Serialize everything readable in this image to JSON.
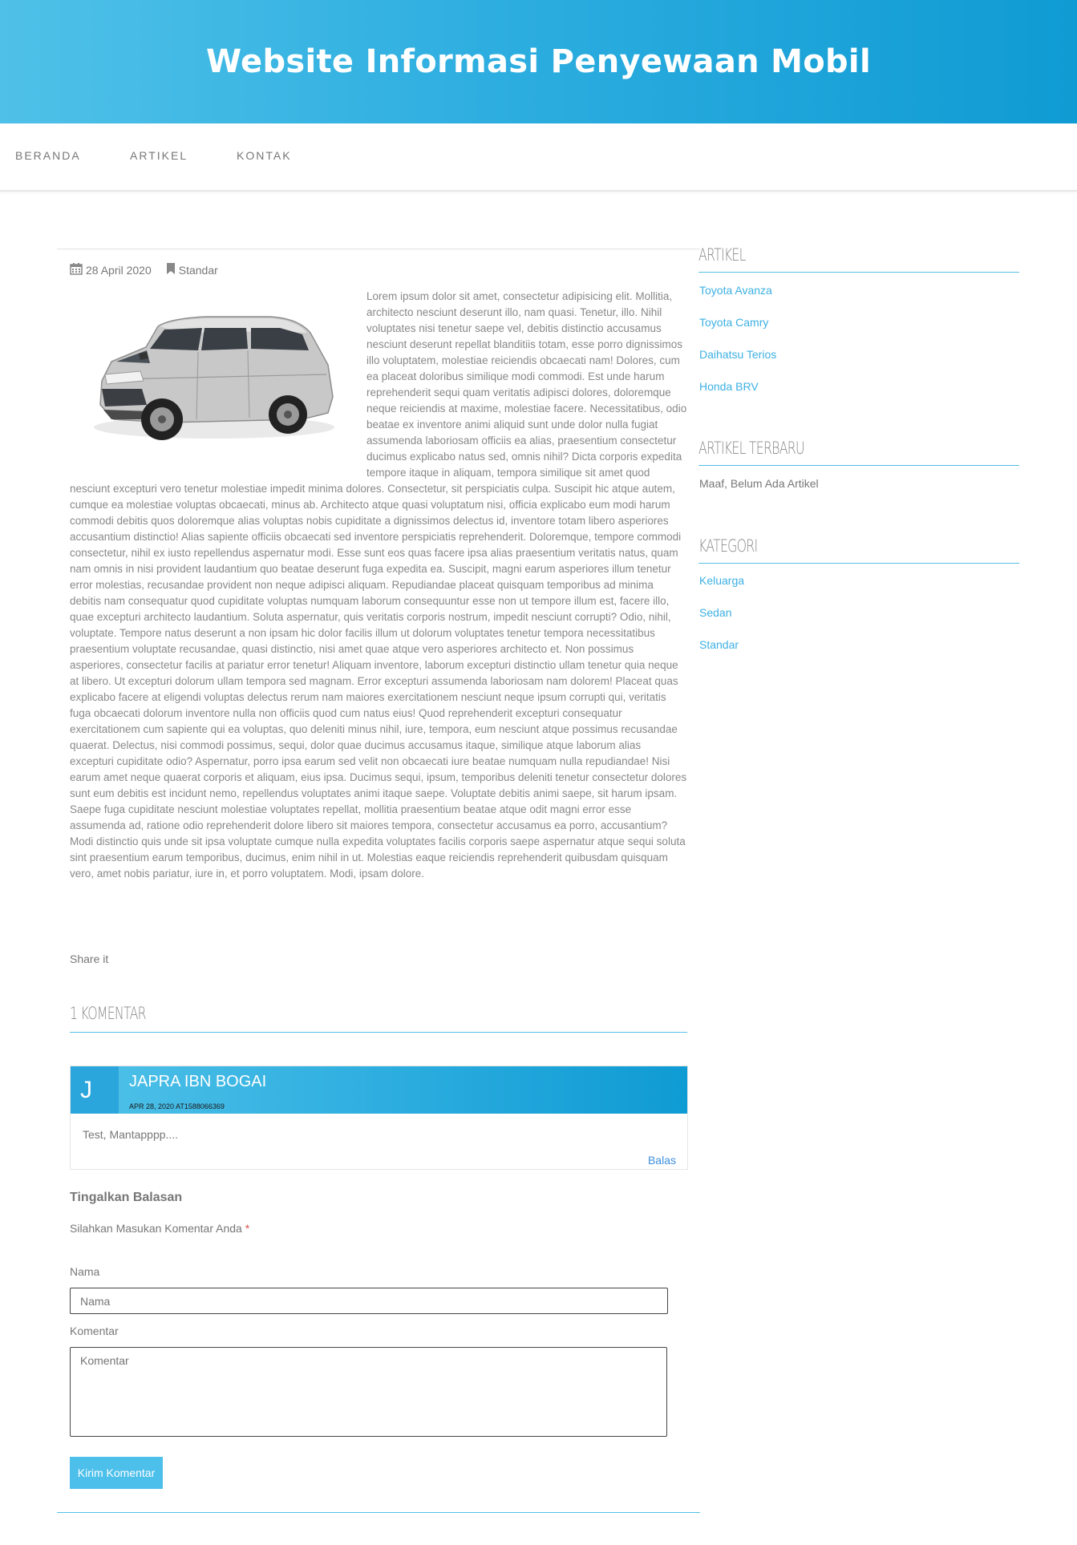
{
  "site": {
    "title": "Website Informasi Penyewaan Mobil"
  },
  "nav": {
    "items": [
      "BERANDA",
      "ARTIKEL",
      "KONTAK"
    ]
  },
  "post": {
    "date": "28 April 2020",
    "category": "Standar",
    "image_alt": "Toyota Avanza",
    "body": "Lorem ipsum dolor sit amet, consectetur adipisicing elit. Mollitia, architecto nesciunt deserunt illo, nam quasi. Tenetur, illo. Nihil voluptates nisi tenetur saepe vel, debitis distinctio accusamus nesciunt deserunt repellat blanditiis totam, esse porro dignissimos illo voluptatem, molestiae reiciendis obcaecati nam! Dolores, cum ea placeat doloribus similique modi commodi. Est unde harum reprehenderit sequi quam veritatis adipisci dolores, doloremque neque reiciendis at maxime, molestiae facere. Necessitatibus, odio beatae ex inventore animi aliquid sunt unde dolor nulla fugiat assumenda laboriosam officiis ea alias, praesentium consectetur ducimus explicabo natus sed, omnis nihil? Dicta corporis expedita tempore itaque in aliquam, tempora similique sit amet quod nesciunt excepturi vero tenetur molestiae impedit minima dolores. Consectetur, sit perspiciatis culpa. Suscipit hic atque autem, cumque ea molestiae voluptas obcaecati, minus ab. Architecto atque quasi voluptatum nisi, officia explicabo eum modi harum commodi debitis quos doloremque alias voluptas nobis cupiditate a dignissimos delectus id, inventore totam libero asperiores accusantium distinctio! Alias sapiente officiis obcaecati sed inventore perspiciatis reprehenderit. Doloremque, tempore commodi consectetur, nihil ex iusto repellendus aspernatur modi. Esse sunt eos quas facere ipsa alias praesentium veritatis natus, quam nam omnis in nisi provident laudantium quo beatae deserunt fuga expedita ea. Suscipit, magni earum asperiores illum tenetur error molestias, recusandae provident non neque adipisci aliquam. Repudiandae placeat quisquam temporibus ad minima debitis nam consequatur quod cupiditate voluptas numquam laborum consequuntur esse non ut tempore illum est, facere illo, quae excepturi architecto laudantium. Soluta aspernatur, quis veritatis corporis nostrum, impedit nesciunt corrupti? Odio, nihil, voluptate. Tempore natus deserunt a non ipsam hic dolor facilis illum ut dolorum voluptates tenetur tempora necessitatibus praesentium voluptate recusandae, quasi distinctio, nisi amet quae atque vero asperiores architecto et. Non possimus asperiores, consectetur facilis at pariatur error tenetur! Aliquam inventore, laborum excepturi distinctio ullam tenetur quia neque at libero. Ut excepturi dolorum ullam tempora sed magnam. Error excepturi assumenda laboriosam nam dolorem! Placeat quas explicabo facere at eligendi voluptas delectus rerum nam maiores exercitationem nesciunt neque ipsum corrupti qui, veritatis fuga obcaecati dolorum inventore nulla non officiis quod cum natus eius! Quod reprehenderit excepturi consequatur exercitationem cum sapiente qui ea voluptas, quo deleniti minus nihil, iure, tempora, eum nesciunt atque possimus recusandae quaerat. Delectus, nisi commodi possimus, sequi, dolor quae ducimus accusamus itaque, similique atque laborum alias excepturi cupiditate odio? Aspernatur, porro ipsa earum sed velit non obcaecati iure beatae numquam nulla repudiandae! Nisi earum amet neque quaerat corporis et aliquam, eius ipsa. Ducimus sequi, ipsum, temporibus deleniti tenetur consectetur dolores sunt eum debitis est incidunt nemo, repellendus voluptates animi itaque saepe. Voluptate debitis animi saepe, sit harum ipsam. Saepe fuga cupiditate nesciunt molestiae voluptates repellat, mollitia praesentium beatae atque odit magni error esse assumenda ad, ratione odio reprehenderit dolore libero sit maiores tempora, consectetur accusamus ea porro, accusantium? Modi distinctio quis unde sit ipsa voluptate cumque nulla expedita voluptates facilis corporis saepe aspernatur atque sequi soluta sint praesentium earum temporibus, ducimus, enim nihil in ut. Molestias eaque reiciendis reprehenderit quibusdam quisquam vero, amet nobis pariatur, iure in, et porro voluptatem. Modi, ipsam dolore.",
    "share_label": "Share it"
  },
  "comments": {
    "title": "1 KOMENTAR",
    "items": [
      {
        "initial": "J",
        "name": "JAPRA IBN BOGAI",
        "date": "APR 28, 2020 AT1588066369",
        "text": "Test, Mantapppp....",
        "reply_label": "Balas"
      }
    ]
  },
  "reply_form": {
    "title": "Tingalkan Balasan",
    "note": "Silahkan Masukan Komentar Anda",
    "required_mark": "*",
    "name_label": "Nama",
    "name_placeholder": "Nama",
    "comment_label": "Komentar",
    "comment_placeholder": "Komentar",
    "submit_label": "Kirim Komentar"
  },
  "sidebar": {
    "articles": {
      "title": "ARTIKEL",
      "items": [
        "Toyota Avanza",
        "Toyota Camry",
        "Daihatsu Terios",
        "Honda BRV"
      ]
    },
    "recent": {
      "title": "ARTIKEL TERBARU",
      "empty_text": "Maaf, Belum Ada Artikel"
    },
    "categories": {
      "title": "KATEGORI",
      "items": [
        "Keluarga",
        "Sedan",
        "Standar"
      ]
    }
  },
  "colors": {
    "accent": "#2eaee0",
    "link": "#3cb0e3",
    "button": "#4cbfea"
  },
  "icons": {
    "date": "calendar-icon",
    "category": "bookmark-icon"
  }
}
